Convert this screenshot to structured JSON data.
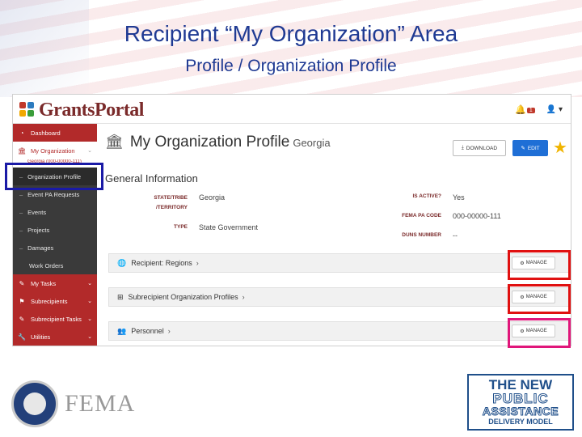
{
  "slide": {
    "title": "Recipient “My Organization” Area",
    "subtitle": "Profile / Organization Profile"
  },
  "app": {
    "logo_text": "GrantsPortal",
    "notification_count": "1"
  },
  "sidebar": {
    "items": [
      {
        "label": "Dashboard",
        "icon": "dashboard-icon"
      },
      {
        "label": "My Organization",
        "icon": "bank-icon"
      },
      {
        "label": "Organization Profile"
      },
      {
        "label": "Event PA Requests"
      },
      {
        "label": "Events"
      },
      {
        "label": "Projects"
      },
      {
        "label": "Damages"
      },
      {
        "label": "Work Orders"
      },
      {
        "label": "My Tasks",
        "icon": "tasks-icon"
      },
      {
        "label": "Subrecipients",
        "icon": "subrecipients-icon"
      },
      {
        "label": "Subrecipient Tasks",
        "icon": "tasks-icon"
      },
      {
        "label": "Utilities",
        "icon": "wrench-icon"
      }
    ],
    "org_id": "Georgia (000-00000-111)"
  },
  "main": {
    "title": "My Organization Profile",
    "org_name": "Georgia",
    "download_label": "DOWNLOAD",
    "edit_label": "EDIT",
    "section_title": "General Information",
    "fields": {
      "state_label": "STATE/TRIBE /TERRITORY",
      "state_value": "Georgia",
      "type_label": "TYPE",
      "type_value": "State Government",
      "active_label": "IS ACTIVE?",
      "active_value": "Yes",
      "pa_code_label": "FEMA PA CODE",
      "pa_code_value": "000-00000-111",
      "duns_label": "DUNS NUMBER",
      "duns_value": "--"
    },
    "panels": [
      {
        "label": "Recipient: Regions",
        "manage": "MANAGE"
      },
      {
        "label": "Subrecipient Organization Profiles",
        "manage": "MANAGE"
      },
      {
        "label": "Personnel",
        "manage": "MANAGE"
      }
    ]
  },
  "footer": {
    "fema_text": "FEMA",
    "pa_line1": "THE NEW",
    "pa_line2": "PUBLIC",
    "pa_line3": "ASSISTANCE",
    "pa_line4": "DELIVERY MODEL"
  },
  "colors": {
    "title_blue": "#1f3a93",
    "sidebar_red": "#b22a2a",
    "sidebar_dark": "#3a3a3a",
    "edit_blue": "#1f6fd6",
    "highlight_blue": "#1a1aa6",
    "highlight_red": "#e01010",
    "highlight_pink": "#e0167a"
  }
}
